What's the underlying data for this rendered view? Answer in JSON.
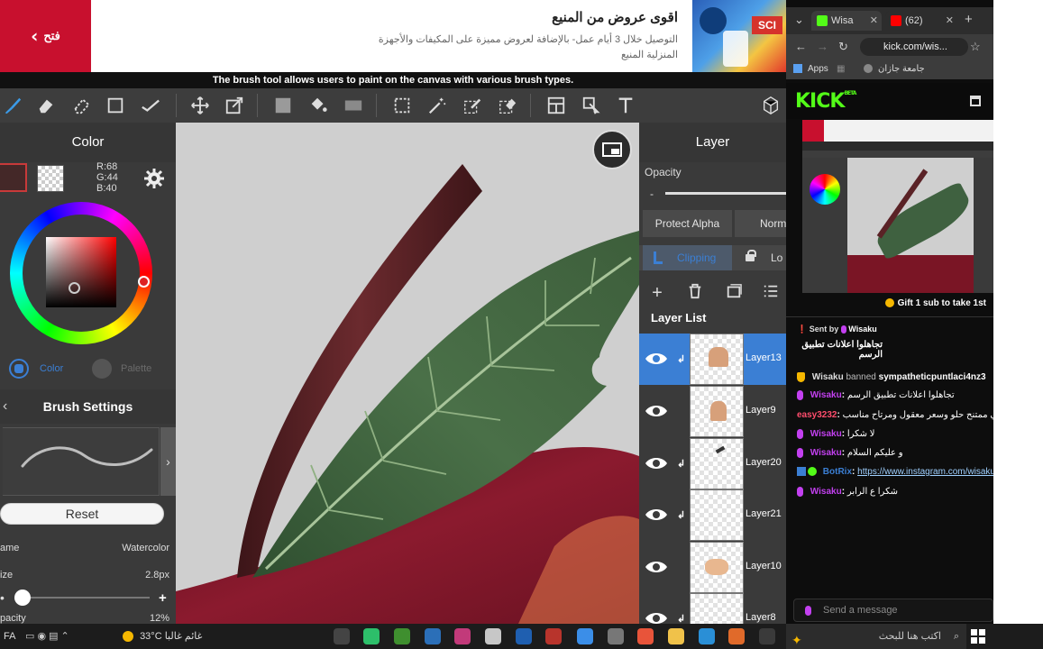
{
  "ad": {
    "open_label": "فتح",
    "title": "اقوى عروض من المنيع",
    "description": "التوصيل خلال 3 أيام عمل- بالإضافة لعروض مميزة على المكيفات والأجهزة المنزلية المنيع",
    "image_text": "SCI"
  },
  "tooltip": "The brush tool allows users to paint on the canvas with various brush types.",
  "color_panel": {
    "title": "Color",
    "rgb_r": "R:68",
    "rgb_g": "G:44",
    "rgb_b": "B:40",
    "main_color": "#442c28",
    "tab_color": "Color",
    "tab_palette": "Palette"
  },
  "brush_settings": {
    "title": "Brush Settings",
    "reset_label": "Reset",
    "name_label": "ame",
    "name_value": "Watercolor",
    "size_label": "ize",
    "size_value": "2.8px",
    "opacity_label": "pacity",
    "opacity_value": "12%"
  },
  "layer_panel": {
    "title": "Layer",
    "opacity_label": "Opacity",
    "opacity_minus": "-",
    "protect_alpha": "Protect Alpha",
    "blend_mode": "Norm",
    "clipping": "Clipping",
    "lock": "Lo",
    "layer_list_label": "Layer List",
    "layers": [
      {
        "name": "Layer13",
        "selected": true,
        "clipped": true
      },
      {
        "name": "Layer9",
        "selected": false,
        "clipped": false
      },
      {
        "name": "Layer20",
        "selected": false,
        "clipped": true
      },
      {
        "name": "Layer21",
        "selected": false,
        "clipped": true
      },
      {
        "name": "Layer10",
        "selected": false,
        "clipped": false
      },
      {
        "name": "Layer8",
        "selected": false,
        "clipped": true
      }
    ]
  },
  "browser": {
    "tab1": "Wisa",
    "tab2": "(62)",
    "url": "kick.com/wis...",
    "bookmark_apps": "Apps",
    "bookmark_uni": "جامعة جازان"
  },
  "kick": {
    "logo": "KICK",
    "logo_sup": "BETA",
    "gift_text": "Gift 1 sub to take 1st",
    "sent_by_label": "Sent by",
    "sent_by_user": "Wisaku",
    "sent_message": "تجاهلوا اعلانات تطبيق الرسم",
    "chat": [
      {
        "user": "Wisaku",
        "action": "banned",
        "target": "sympatheticpuntlaci4nz3",
        "type": "ban"
      },
      {
        "user": "Wisaku",
        "text": "تجاهلوا اعلانات تطبيق الرسم",
        "type": "msg"
      },
      {
        "user": "easy3232",
        "text": "ويركاته في ممتنح حلو وسعر معقول ومرتاح مناسب",
        "type": "msg"
      },
      {
        "user": "Wisaku",
        "text": "لا شكرا",
        "type": "msg"
      },
      {
        "user": "Wisaku",
        "text": "و عليكم السلام",
        "type": "msg"
      },
      {
        "user": "BotRix",
        "text": "https://www.instagram.com/wisaku_",
        "type": "bot"
      },
      {
        "user": "Wisaku",
        "text": "شكرا ع الرابر",
        "type": "msg"
      }
    ],
    "chat_colors": {
      "Wisaku": "#c340f0",
      "easy3232": "#ff4d6d",
      "BotRix": "#3b7fd4"
    },
    "input_placeholder": "Send a message"
  },
  "taskbar": {
    "left_text": "FA",
    "temperature": "33°C",
    "weather_text": "غائم غالبا",
    "search_text": "اكتب هنا للبحث"
  }
}
